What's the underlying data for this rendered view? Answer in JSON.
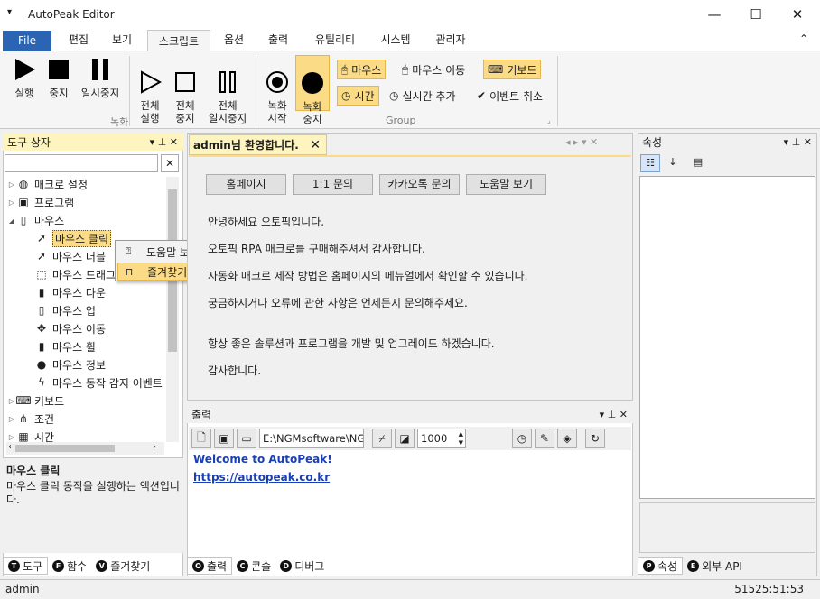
{
  "app": {
    "title": "AutoPeak Editor"
  },
  "window": {
    "menu_glyph": "▾",
    "min": "—",
    "max": "☐",
    "close": "✕",
    "ribbon_collapse": "⌃"
  },
  "menu_tabs": [
    "File",
    "편집",
    "보기",
    "스크립트",
    "옵션",
    "출력",
    "유틸리티",
    "시스템",
    "관리자"
  ],
  "ribbon": {
    "run": "실행",
    "stop": "중지",
    "pause": "일시중지",
    "run_all": "전체\n실행",
    "stop_all": "전체\n중지",
    "pause_all": "전체\n일시중지",
    "record_start": "녹화\n시작",
    "record_stop": "녹화\n중지",
    "group_record": "녹화",
    "group_group": "Group",
    "mouse": "마우스",
    "mouse_move": "마우스 이동",
    "keyboard": "키보드",
    "time": "시간",
    "realtime_add": "실시간 추가",
    "event_cancel": "이벤트 취소"
  },
  "toolbox": {
    "title": "도구 상자",
    "pin": "▾ ⊥ ✕",
    "search_clear": "✕",
    "items": [
      {
        "label": "매크로 설정",
        "icon": "globe-icon",
        "level": 0,
        "arrow": "▷"
      },
      {
        "label": "프로그램",
        "icon": "program-icon",
        "level": 0,
        "arrow": "▷"
      },
      {
        "label": "마우스",
        "icon": "mouse-icon",
        "level": 0,
        "arrow": "◢"
      },
      {
        "label": "마우스 클릭",
        "icon": "mouse-click-icon",
        "level": 1,
        "arrow": ""
      },
      {
        "label": "마우스 더블",
        "icon": "mouse-double-icon",
        "level": 1,
        "arrow": ""
      },
      {
        "label": "마우스 드래그",
        "icon": "mouse-drag-icon",
        "level": 1,
        "arrow": ""
      },
      {
        "label": "마우스 다운",
        "icon": "mouse-down-icon",
        "level": 1,
        "arrow": ""
      },
      {
        "label": "마우스 업",
        "icon": "mouse-up-icon",
        "level": 1,
        "arrow": ""
      },
      {
        "label": "마우스 이동",
        "icon": "mouse-move-icon",
        "level": 1,
        "arrow": ""
      },
      {
        "label": "마우스 휠",
        "icon": "mouse-wheel-icon",
        "level": 1,
        "arrow": ""
      },
      {
        "label": "마우스 정보",
        "icon": "mouse-info-icon",
        "level": 1,
        "arrow": ""
      },
      {
        "label": "마우스 동작 감지 이벤트",
        "icon": "lightning-icon",
        "level": 1,
        "arrow": ""
      },
      {
        "label": "키보드",
        "icon": "keyboard-icon",
        "level": 0,
        "arrow": "▷"
      },
      {
        "label": "조건",
        "icon": "condition-icon",
        "level": 0,
        "arrow": "▷"
      },
      {
        "label": "시간",
        "icon": "calendar-icon",
        "level": 0,
        "arrow": "▷"
      }
    ],
    "desc_title": "마우스 클릭",
    "desc_text": "마우스 클릭 동작을 실행하는 액션입니다.",
    "tabs": [
      {
        "label": "도구",
        "letter": "T"
      },
      {
        "label": "함수",
        "letter": "F"
      },
      {
        "label": "즐겨찾기",
        "letter": "V"
      }
    ]
  },
  "context_menu": {
    "items": [
      "도움말 보기",
      "즐겨찾기 추가"
    ]
  },
  "welcome": {
    "tab": "admin님 환영합니다.",
    "buttons": [
      "홈페이지",
      "1:1 문의",
      "카카오톡 문의",
      "도움말 보기"
    ],
    "lines": [
      "안녕하세요 오토픽입니다.",
      "오토픽 RPA 매크로를 구매해주셔서 감사합니다.",
      "자동화 매크로 제작 방법은 홈페이지의 메뉴얼에서 확인할 수 있습니다.",
      "궁금하시거나 오류에 관한 사항은 언제든지 문의해주세요.",
      "항상 좋은 솔루션과 프로그램을 개발 및 업그레이드 하겠습니다.",
      "감사합니다."
    ]
  },
  "output": {
    "title": "출력",
    "path": "E:\\NGMsoftware\\NG",
    "number": "1000",
    "line1": "Welcome to AutoPeak!",
    "line2": "https://autopeak.co.kr",
    "tabs": [
      {
        "label": "출력",
        "letter": "O"
      },
      {
        "label": "콘솔",
        "letter": "C"
      },
      {
        "label": "디버그",
        "letter": "D"
      }
    ]
  },
  "properties": {
    "title": "속성",
    "tabs": [
      {
        "label": "속성",
        "letter": "P"
      },
      {
        "label": "외부 API",
        "letter": "E"
      }
    ]
  },
  "status": {
    "user": "admin",
    "time": "51525:51:53"
  },
  "colors": {
    "file_tab": "#2b64b3",
    "highlight": "#fbdb86",
    "link": "#1a3fb5",
    "panel_header_active": "#fdf4bf"
  }
}
